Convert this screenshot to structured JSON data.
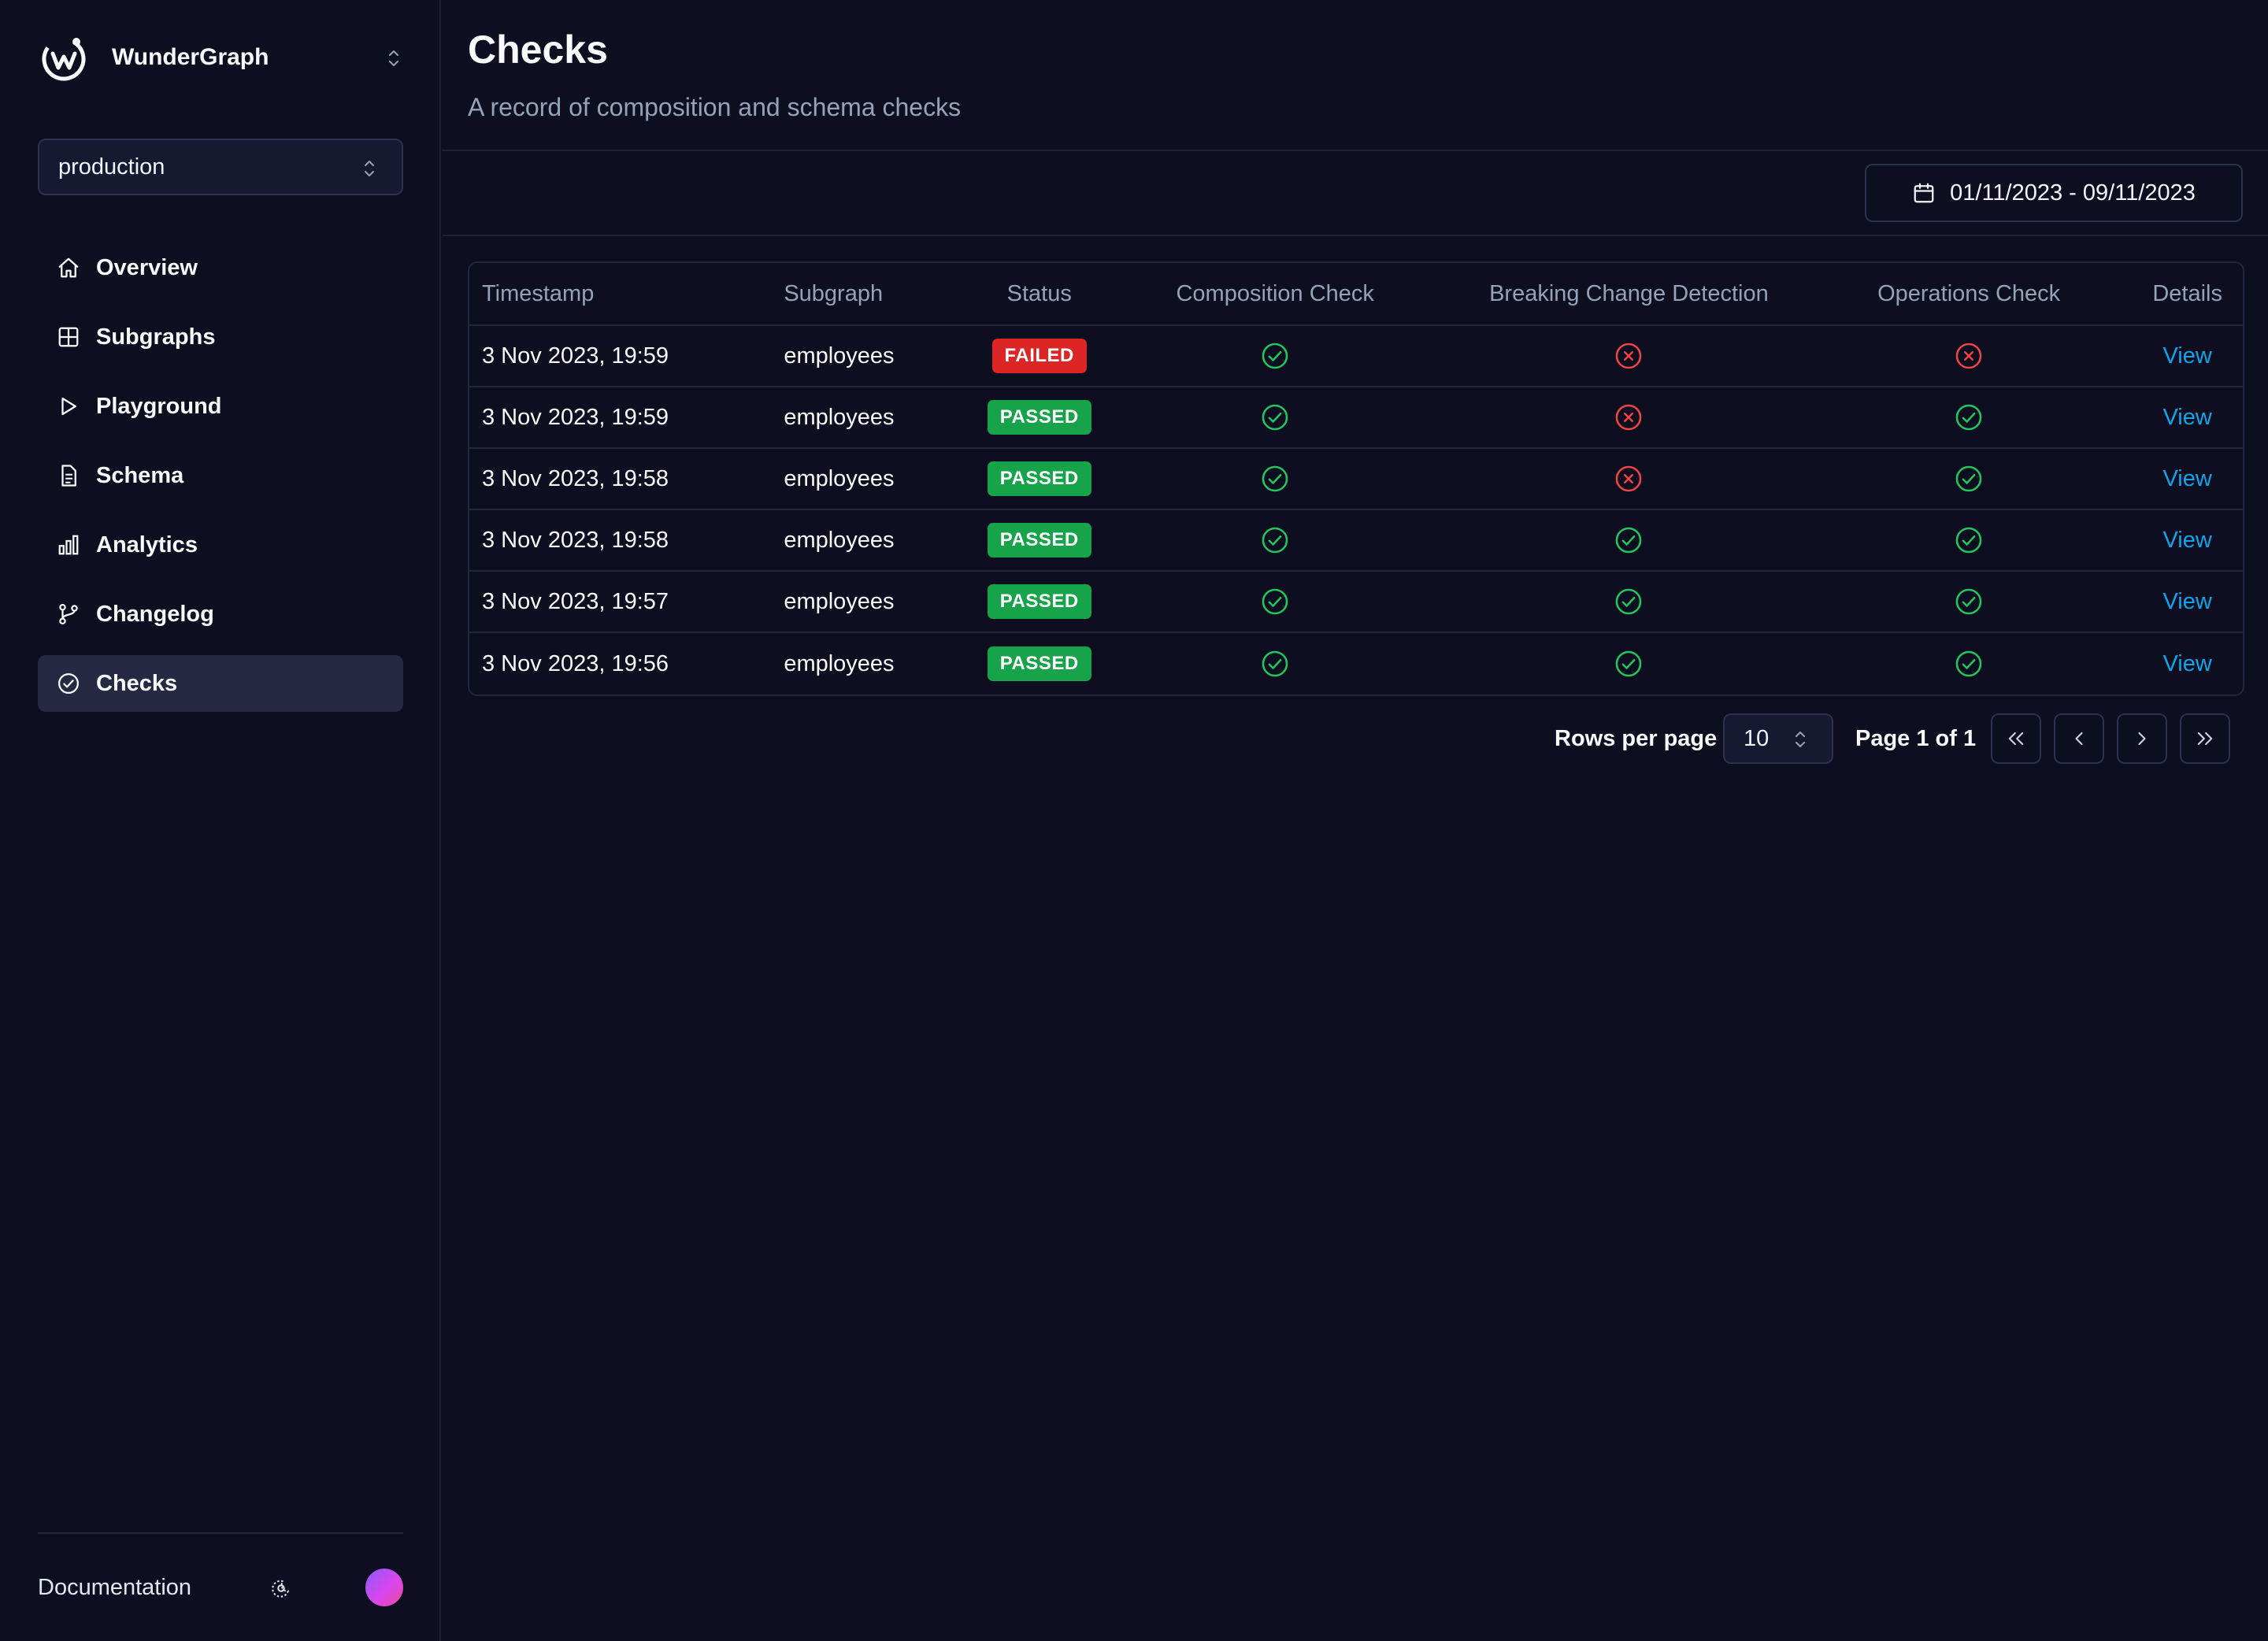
{
  "colors": {
    "background": "#0d0e20",
    "sidebar_active": "#272944",
    "failed": "#dc2626",
    "passed": "#16a34a",
    "check_green": "#22c55e",
    "cross_red": "#ef4444",
    "link": "#0ea5e9"
  },
  "brand": {
    "name": "WunderGraph",
    "logo": "wundergraph-logo",
    "switch_icon": "chevron-up-down-icon"
  },
  "environment": {
    "selected": "production"
  },
  "sidebar": {
    "items": [
      {
        "label": "Overview",
        "icon": "home-icon",
        "active": false
      },
      {
        "label": "Subgraphs",
        "icon": "grid-icon",
        "active": false
      },
      {
        "label": "Playground",
        "icon": "play-icon",
        "active": false
      },
      {
        "label": "Schema",
        "icon": "file-text-icon",
        "active": false
      },
      {
        "label": "Analytics",
        "icon": "bar-chart-icon",
        "active": false
      },
      {
        "label": "Changelog",
        "icon": "git-branch-icon",
        "active": false
      },
      {
        "label": "Checks",
        "icon": "check-circle-icon",
        "active": true
      }
    ],
    "footer": {
      "documentation": "Documentation",
      "theme_icon": "moon-sun-icon"
    }
  },
  "page": {
    "title": "Checks",
    "subtitle": "A record of composition and schema checks"
  },
  "date_range": {
    "label": "01/11/2023 - 09/11/2023",
    "icon": "calendar-icon"
  },
  "table": {
    "columns": [
      "Timestamp",
      "Subgraph",
      "Status",
      "Composition Check",
      "Breaking Change Detection",
      "Operations Check",
      "Details"
    ],
    "rows": [
      {
        "timestamp": "3 Nov 2023, 19:59",
        "subgraph": "employees",
        "status": "FAILED",
        "composition": true,
        "breaking": false,
        "operations": false,
        "details": "View"
      },
      {
        "timestamp": "3 Nov 2023, 19:59",
        "subgraph": "employees",
        "status": "PASSED",
        "composition": true,
        "breaking": false,
        "operations": true,
        "details": "View"
      },
      {
        "timestamp": "3 Nov 2023, 19:58",
        "subgraph": "employees",
        "status": "PASSED",
        "composition": true,
        "breaking": false,
        "operations": true,
        "details": "View"
      },
      {
        "timestamp": "3 Nov 2023, 19:58",
        "subgraph": "employees",
        "status": "PASSED",
        "composition": true,
        "breaking": true,
        "operations": true,
        "details": "View"
      },
      {
        "timestamp": "3 Nov 2023, 19:57",
        "subgraph": "employees",
        "status": "PASSED",
        "composition": true,
        "breaking": true,
        "operations": true,
        "details": "View"
      },
      {
        "timestamp": "3 Nov 2023, 19:56",
        "subgraph": "employees",
        "status": "PASSED",
        "composition": true,
        "breaking": true,
        "operations": true,
        "details": "View"
      }
    ]
  },
  "pagination": {
    "rows_per_page_label": "Rows per page",
    "rows_per_page": "10",
    "page_info": "Page 1 of 1"
  }
}
